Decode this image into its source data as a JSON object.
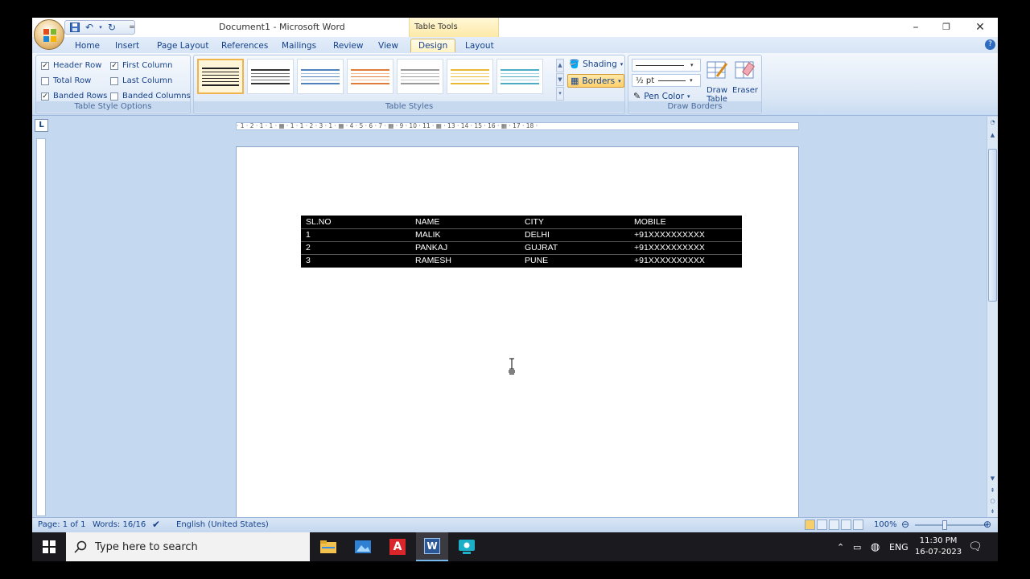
{
  "window": {
    "doc_title": "Document1 - Microsoft Word",
    "context_title": "Table Tools"
  },
  "tabs": [
    "Home",
    "Insert",
    "Page Layout",
    "References",
    "Mailings",
    "Review",
    "View",
    "Design",
    "Layout"
  ],
  "active_tab": "Design",
  "ribbon": {
    "table_style_options": {
      "label": "Table Style Options",
      "options": [
        {
          "label": "Header Row",
          "checked": true
        },
        {
          "label": "First Column",
          "checked": true
        },
        {
          "label": "Total Row",
          "checked": false
        },
        {
          "label": "Last Column",
          "checked": false
        },
        {
          "label": "Banded Rows",
          "checked": true
        },
        {
          "label": "Banded Columns",
          "checked": false
        }
      ]
    },
    "table_styles": {
      "label": "Table Styles",
      "shading_label": "Shading",
      "borders_label": "Borders",
      "swatch_colors": [
        "#222222",
        "#333333",
        "#4f81bd",
        "#e07b39",
        "#9a9a9a",
        "#e8b935",
        "#4bacc6"
      ]
    },
    "draw_borders": {
      "label": "Draw Borders",
      "pen_weight": "½ pt",
      "pen_color_label": "Pen Color",
      "draw_table_label": "Draw Table",
      "eraser_label": "Eraser"
    }
  },
  "ruler_text": "· 1 · 2 · 1 · 1 · ▦ · 1 · 1 · 2 · 3 · 1 · ▦ · 4 · 5 · 6 · 7 · ▦ · 9 · 10 · 11 · ▦ · 13 · 14 · 15 · 16 · ▦ · 17 · 18 ·",
  "table": {
    "rows": [
      [
        "SL.NO",
        "NAME",
        "CITY",
        "MOBILE"
      ],
      [
        "1",
        "MALIK",
        "DELHI",
        "+91XXXXXXXXXX"
      ],
      [
        "2",
        "PANKAJ",
        "GUJRAT",
        "+91XXXXXXXXXX"
      ],
      [
        "3",
        "RAMESH",
        "PUNE",
        "+91XXXXXXXXXX"
      ]
    ]
  },
  "status": {
    "page": "Page: 1 of 1",
    "words": "Words: 16/16",
    "language": "English (United States)",
    "zoom": "100%"
  },
  "taskbar": {
    "search_placeholder": "Type here to search",
    "lang": "ENG",
    "time": "11:30 PM",
    "date": "16-07-2023"
  }
}
